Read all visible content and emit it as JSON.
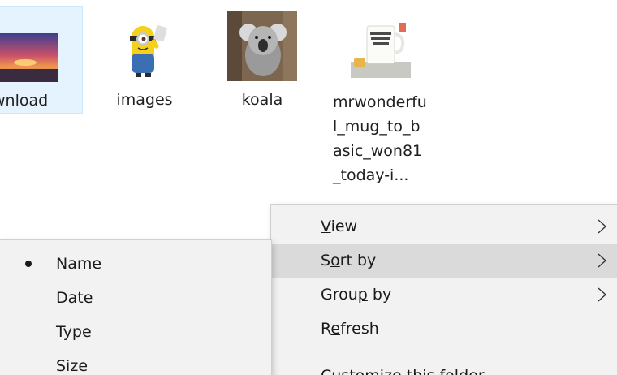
{
  "files": [
    {
      "name": "wnload",
      "thumbnail": "sunset-photo",
      "selected": true
    },
    {
      "name": "images",
      "thumbnail": "minion-image",
      "selected": false
    },
    {
      "name": "koala",
      "thumbnail": "koala-photo",
      "selected": false
    },
    {
      "name": "mrwonderful_mug_to_basic_won81_today-i...",
      "thumbnail": "mug-photo",
      "selected": false
    }
  ],
  "context_menu": {
    "items": [
      {
        "label_pre": "",
        "accel": "V",
        "label_post": "iew",
        "has_submenu": true
      },
      {
        "label_pre": "S",
        "accel": "o",
        "label_post": "rt by",
        "has_submenu": true,
        "highlighted": true
      },
      {
        "label_pre": "Grou",
        "accel": "p",
        "label_post": " by",
        "has_submenu": true
      },
      {
        "label_pre": "R",
        "accel": "e",
        "label_post": "fresh",
        "has_submenu": false
      },
      {
        "label": "Customize this folder"
      }
    ]
  },
  "sort_submenu": {
    "items": [
      {
        "label": "Name",
        "checked": true
      },
      {
        "label": "Date",
        "checked": false
      },
      {
        "label": "Type",
        "checked": false
      },
      {
        "label": "Size",
        "checked": false
      }
    ]
  },
  "colors": {
    "selection_bg": "#e5f3ff",
    "menu_bg": "#f2f2f2",
    "menu_hover": "#dadada"
  }
}
